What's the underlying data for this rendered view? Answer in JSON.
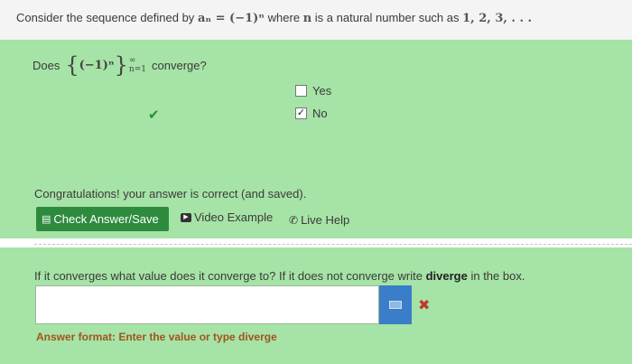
{
  "question": {
    "prefix": "Consider the sequence defined by",
    "definition": "aₙ = (−1)ⁿ",
    "middle": "where",
    "var": "n",
    "suffix": "is a natural number such as",
    "examples": "1, 2, 3, . . ."
  },
  "part1": {
    "does": "Does",
    "sequence": "(−1)ⁿ",
    "upper_limit": "∞",
    "lower_limit": "n=1",
    "converge": "converge?",
    "options": [
      {
        "label": "Yes",
        "checked": false
      },
      {
        "label": "No",
        "checked": true
      }
    ],
    "result_mark": "✔",
    "congrats": "Congratulations! your answer is correct (and saved)."
  },
  "buttons": {
    "check": "Check Answer/Save",
    "video": "Video Example",
    "live": "Live Help"
  },
  "part2": {
    "question_before": "If it converges what value does it converge to? If it does not converge write",
    "question_bold": "diverge",
    "question_after": "in the box.",
    "input_value": "",
    "result_mark": "✖",
    "format_note": "Answer format: Enter the value or type diverge"
  },
  "colors": {
    "correct_bg": "#a6e3a6",
    "check_button": "#2e8b3e",
    "keyboard_button": "#3a7dc9",
    "wrong": "#c0392b",
    "format_note": "#a2541e"
  },
  "icons": {
    "check_button": "save-icon",
    "video": "play-icon",
    "live": "phone-icon",
    "keyboard": "keyboard-icon"
  }
}
